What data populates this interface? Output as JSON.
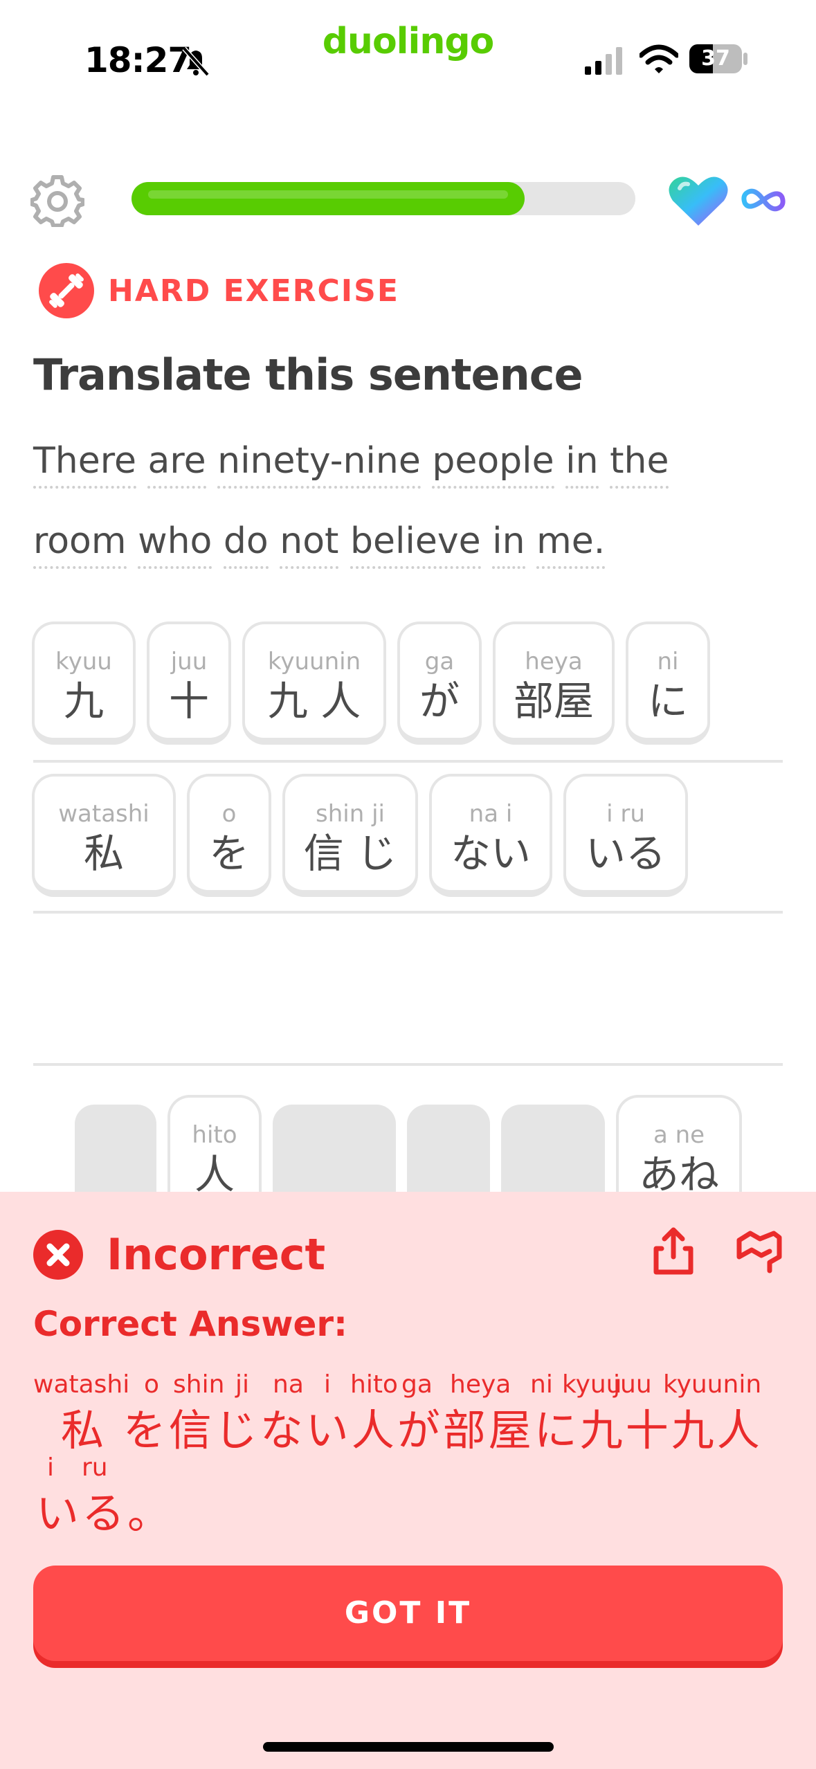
{
  "status_bar": {
    "time": "18:27",
    "battery": "37",
    "brand": "duolingo"
  },
  "header": {
    "progress": 0.78,
    "hearts": "∞"
  },
  "exercise": {
    "badge": "HARD EXERCISE",
    "title": "Translate this sentence",
    "sentence_line1": [
      "There",
      "are",
      "ninety-nine",
      "people",
      "in",
      "the"
    ],
    "sentence_line2": [
      "room",
      "who",
      "do",
      "not",
      "believe",
      "in",
      "me."
    ]
  },
  "answer_row1": [
    {
      "reading": "kyuu",
      "text": "九"
    },
    {
      "reading": "juu",
      "text": "十"
    },
    {
      "reading": "kyuunin",
      "text": "九 人"
    },
    {
      "reading": "ga",
      "text": "が"
    },
    {
      "reading": "heya",
      "text": "部屋"
    },
    {
      "reading": "ni",
      "text": "に"
    }
  ],
  "answer_row2": [
    {
      "reading": "watashi",
      "text": "私"
    },
    {
      "reading": "o",
      "text": "を"
    },
    {
      "reading": "shin  ji",
      "text": "信 じ"
    },
    {
      "reading": "na   i",
      "text": "ない"
    },
    {
      "reading": "i   ru",
      "text": "いる"
    }
  ],
  "word_bank_visible": [
    {
      "reading": "hito",
      "text": "人"
    },
    {
      "reading": "a  ne",
      "text": "あね"
    }
  ],
  "feedback": {
    "status": "Incorrect",
    "correct_label": "Correct Answer:",
    "line1_readings": [
      "watashi",
      "o",
      "shin",
      "ji",
      "na",
      "i",
      "hito",
      "ga",
      "heya",
      "ni",
      "kyuu",
      "juu",
      "kyuunin"
    ],
    "line1_text": "私 を信じない人が部屋に九十九人",
    "line2_readings": [
      "i",
      "ru"
    ],
    "line2_text": "いる。",
    "button": "GOT IT"
  },
  "colors": {
    "green": "#58cc02",
    "red": "#ff4b4b",
    "dark_red": "#ea2b2b",
    "sheet": "#ffdfe0"
  }
}
